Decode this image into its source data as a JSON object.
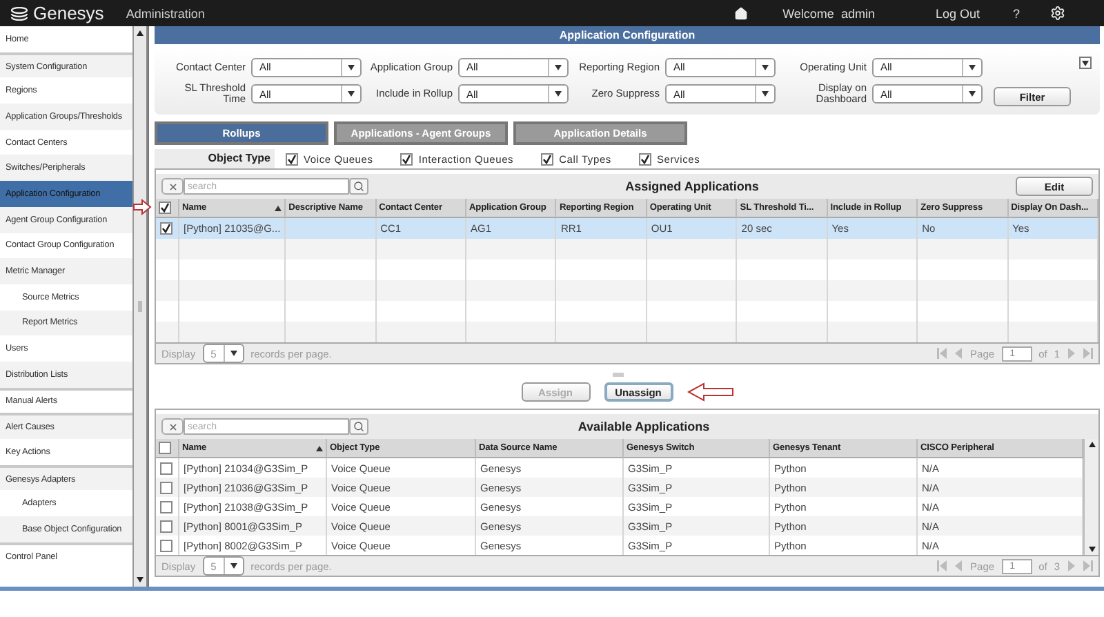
{
  "header": {
    "brand": "Genesys",
    "section": "Administration",
    "welcome": "Welcome  admin",
    "logout": "Log Out",
    "help": "?"
  },
  "sidebar": {
    "items": [
      {
        "label": "Home",
        "selected": false,
        "group_start": false
      },
      {
        "label": "System Configuration",
        "selected": false,
        "group_start": true
      },
      {
        "label": "Regions",
        "selected": false,
        "group_start": false
      },
      {
        "label": "Application Groups/Thresholds",
        "selected": false,
        "group_start": false
      },
      {
        "label": "Contact Centers",
        "selected": false,
        "group_start": false
      },
      {
        "label": "Switches/Peripherals",
        "selected": false,
        "group_start": false
      },
      {
        "label": "Application Configuration",
        "selected": true,
        "group_start": false
      },
      {
        "label": "Agent Group Configuration",
        "selected": false,
        "group_start": false
      },
      {
        "label": "Contact Group Configuration",
        "selected": false,
        "group_start": false
      },
      {
        "label": "Metric Manager",
        "selected": false,
        "group_start": false,
        "children": [
          {
            "label": "Source Metrics",
            "selected": false
          },
          {
            "label": "Report Metrics",
            "selected": false
          }
        ]
      },
      {
        "label": "Users",
        "selected": false,
        "group_start": false
      },
      {
        "label": "Distribution Lists",
        "selected": false,
        "group_start": false
      },
      {
        "label": "Manual Alerts",
        "selected": false,
        "group_start": true
      },
      {
        "label": "Alert Causes",
        "selected": false,
        "group_start": true
      },
      {
        "label": "Key Actions",
        "selected": false,
        "group_start": false
      },
      {
        "label": "Genesys Adapters",
        "selected": false,
        "group_start": true,
        "children": [
          {
            "label": "Adapters",
            "selected": false
          },
          {
            "label": "Base Object Configuration",
            "selected": false
          }
        ]
      },
      {
        "label": "Control Panel",
        "selected": false,
        "group_start": true
      }
    ]
  },
  "page_title": "Application Configuration",
  "filters": [
    {
      "label": "Contact Center",
      "value": "All"
    },
    {
      "label": "Application Group",
      "value": "All"
    },
    {
      "label": "Reporting Region",
      "value": "All"
    },
    {
      "label": "Operating Unit",
      "value": "All"
    },
    {
      "label": "SL Threshold Time",
      "value": "All"
    },
    {
      "label": "Include in Rollup",
      "value": "All"
    },
    {
      "label": "Zero Suppress",
      "value": "All"
    },
    {
      "label": "Display on Dashboard",
      "value": "All"
    }
  ],
  "filter_button": "Filter",
  "tabs": [
    {
      "label": "Rollups",
      "selected": true
    },
    {
      "label": "Applications - Agent Groups",
      "selected": false
    },
    {
      "label": "Application Details",
      "selected": false
    }
  ],
  "object_type": {
    "label": "Object Type",
    "options": [
      {
        "label": "Voice Queues",
        "checked": true
      },
      {
        "label": "Interaction Queues",
        "checked": true
      },
      {
        "label": "Call Types",
        "checked": true
      },
      {
        "label": "Services",
        "checked": true
      }
    ]
  },
  "assigned": {
    "title": "Assigned Applications",
    "search_placeholder": "search",
    "edit_button": "Edit",
    "all_checked": true,
    "columns": [
      "Name",
      "Descriptive Name",
      "Contact Center",
      "Application Group",
      "Reporting Region",
      "Operating Unit",
      "SL Threshold Ti...",
      "Include in Rollup",
      "Zero Suppress",
      "Display On Dash..."
    ],
    "rows": [
      {
        "checked": true,
        "selected": true,
        "cells": [
          "[Python] 21035@G...",
          null,
          "CC1",
          "AG1",
          "RR1",
          "OU1",
          "20 sec",
          "Yes",
          "No",
          "Yes"
        ]
      }
    ],
    "display_label": "Display",
    "page_size": "5",
    "per_page": "records per page.",
    "page_label": "Page",
    "page": "1",
    "of_label": "of",
    "pages": "1"
  },
  "assign_button": {
    "label": "Assign",
    "disabled": true
  },
  "unassign_button": {
    "label": "Unassign",
    "disabled": false
  },
  "available": {
    "title": "Available Applications",
    "search_placeholder": "search",
    "all_checked": false,
    "columns": [
      "Name",
      "Object Type",
      "Data Source Name",
      "Genesys Switch",
      "Genesys Tenant",
      "CISCO Peripheral"
    ],
    "rows": [
      {
        "checked": false,
        "selected": false,
        "cells": [
          "[Python] 21034@G3Sim_P",
          "Voice Queue",
          "Genesys",
          "G3Sim_P",
          "Python",
          "N/A"
        ]
      },
      {
        "checked": false,
        "selected": false,
        "cells": [
          "[Python] 21036@G3Sim_P",
          "Voice Queue",
          "Genesys",
          "G3Sim_P",
          "Python",
          "N/A"
        ]
      },
      {
        "checked": false,
        "selected": false,
        "cells": [
          "[Python] 21038@G3Sim_P",
          "Voice Queue",
          "Genesys",
          "G3Sim_P",
          "Python",
          "N/A"
        ]
      },
      {
        "checked": false,
        "selected": false,
        "cells": [
          "[Python] 8001@G3Sim_P",
          "Voice Queue",
          "Genesys",
          "G3Sim_P",
          "Python",
          "N/A"
        ]
      },
      {
        "checked": false,
        "selected": false,
        "cells": [
          "[Python] 8002@G3Sim_P",
          "Voice Queue",
          "Genesys",
          "G3Sim_P",
          "Python",
          "N/A"
        ]
      }
    ],
    "display_label": "Display",
    "page_size": "5",
    "per_page": "records per page.",
    "page_label": "Page",
    "page": "1",
    "of_label": "of",
    "pages": "3"
  }
}
